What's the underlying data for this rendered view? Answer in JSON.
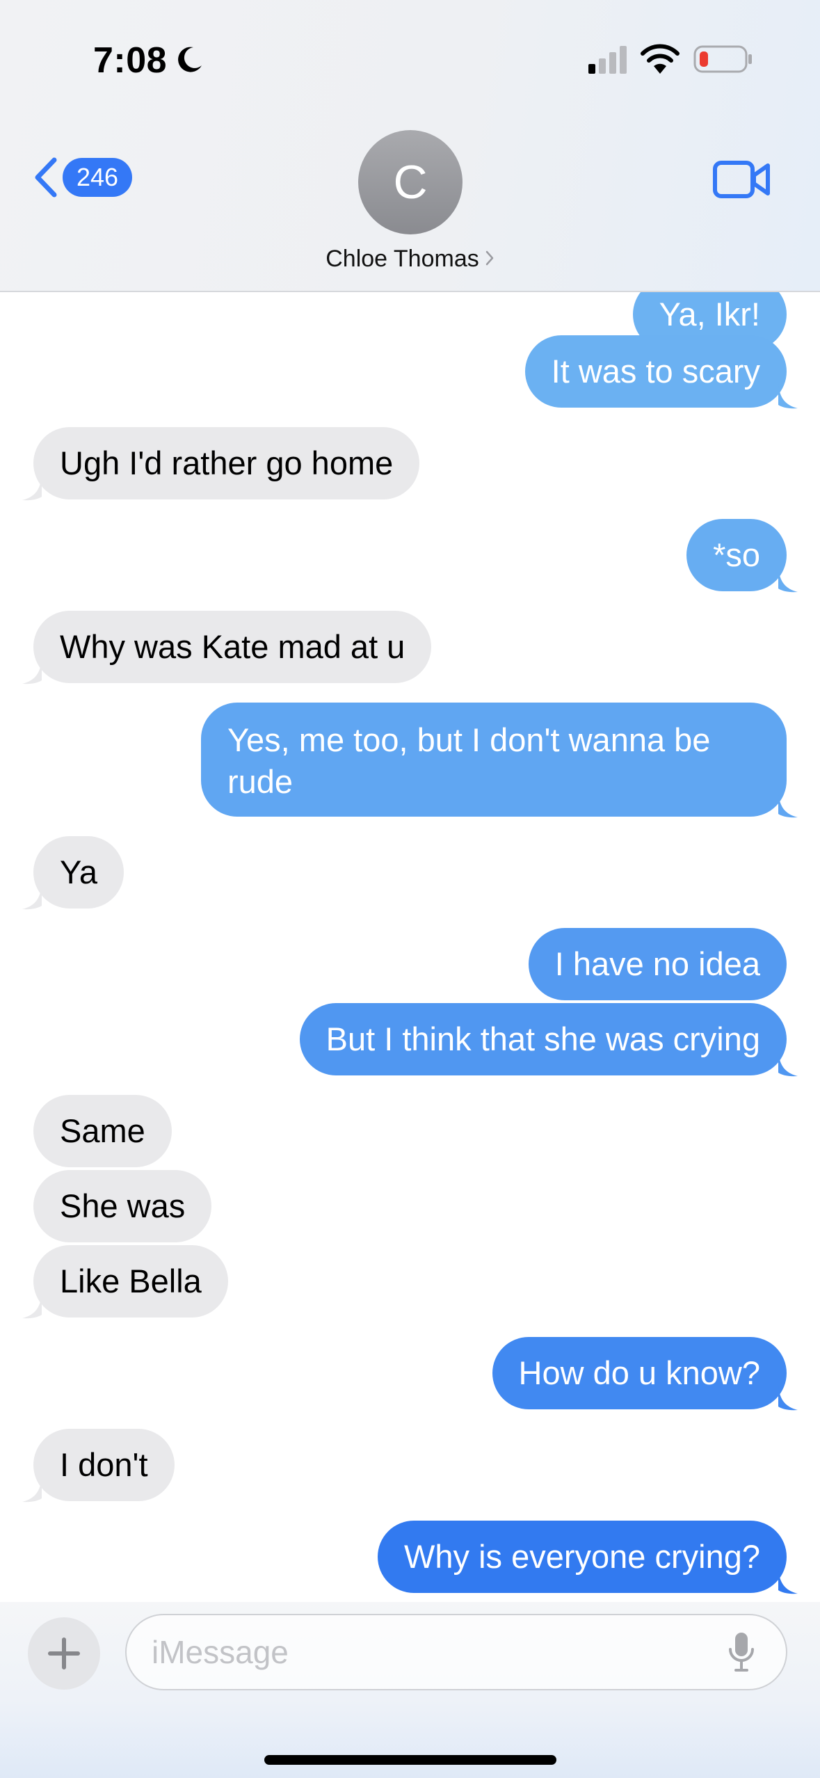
{
  "status_bar": {
    "time": "7:08",
    "icons": [
      "moon-icon",
      "cellular-signal-icon",
      "wifi-icon",
      "battery-low-icon"
    ]
  },
  "header": {
    "back_badge": "246",
    "avatar_initial": "C",
    "contact_name": "Chloe Thomas",
    "icons": [
      "back-chevron-icon",
      "contact-chevron-icon",
      "video-camera-icon"
    ]
  },
  "colors": {
    "outgoing_bubble": "#3478f6",
    "incoming_bubble": "#e9e9eb",
    "accent": "#3478f6"
  },
  "messages": [
    {
      "dir": "out",
      "text": "Ya, Ikr!",
      "tail": false
    },
    {
      "dir": "out",
      "text": "It was to scary",
      "tail": true
    },
    {
      "dir": "in",
      "text": "Ugh I'd rather go home",
      "tail": true
    },
    {
      "dir": "out",
      "text": "*so",
      "tail": true
    },
    {
      "dir": "in",
      "text": "Why was Kate mad at u",
      "tail": true
    },
    {
      "dir": "out",
      "text": "Yes, me too, but I don't wanna be rude",
      "tail": true
    },
    {
      "dir": "in",
      "text": "Ya",
      "tail": true
    },
    {
      "dir": "out",
      "text": "I have no idea",
      "tail": false
    },
    {
      "dir": "out",
      "text": "But I think that she was crying",
      "tail": true
    },
    {
      "dir": "in",
      "text": "Same",
      "tail": false
    },
    {
      "dir": "in",
      "text": "She was",
      "tail": false
    },
    {
      "dir": "in",
      "text": "Like Bella",
      "tail": true
    },
    {
      "dir": "out",
      "text": "How do u know?",
      "tail": true
    },
    {
      "dir": "in",
      "text": "I don't",
      "tail": true
    },
    {
      "dir": "out",
      "text": "Why is everyone crying?",
      "tail": true
    }
  ],
  "composer": {
    "placeholder": "iMessage",
    "icons": [
      "plus-icon",
      "microphone-icon"
    ]
  }
}
